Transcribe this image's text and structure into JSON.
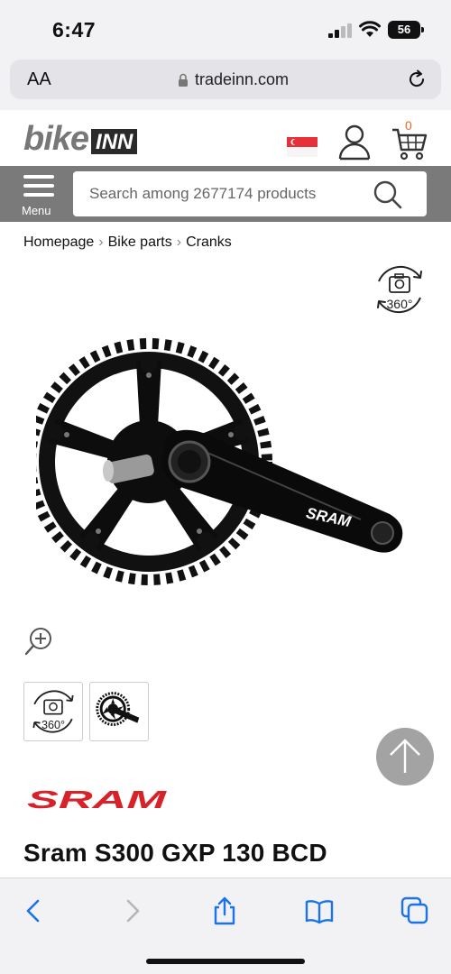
{
  "status_bar": {
    "time": "6:47",
    "battery": "56"
  },
  "browser": {
    "text_size_label": "AA",
    "url": "tradeinn.com"
  },
  "site": {
    "logo_bike": "bike",
    "logo_inn": "INN",
    "cart_count": "0",
    "menu_label": "Menu",
    "search_placeholder": "Search among 2677174 products"
  },
  "breadcrumb": [
    "Homepage",
    "Bike parts",
    "Cranks"
  ],
  "badge_360": "360°",
  "product": {
    "brand": "SRAM",
    "title": "Sram S300 GXP 130 BCD"
  },
  "icons": [
    "lock-icon",
    "reload-icon",
    "flag-icon",
    "user-icon",
    "cart-icon",
    "menu-icon",
    "search-icon",
    "360-view-icon",
    "zoom-in-icon",
    "back-to-top-icon",
    "back-icon",
    "forward-icon",
    "share-icon",
    "bookmarks-icon",
    "tabs-icon"
  ],
  "colors": {
    "accent": "#e2672a",
    "nav": "#7a7a7a",
    "brand_red": "#d8222a",
    "ios_blue": "#1a73e8"
  }
}
